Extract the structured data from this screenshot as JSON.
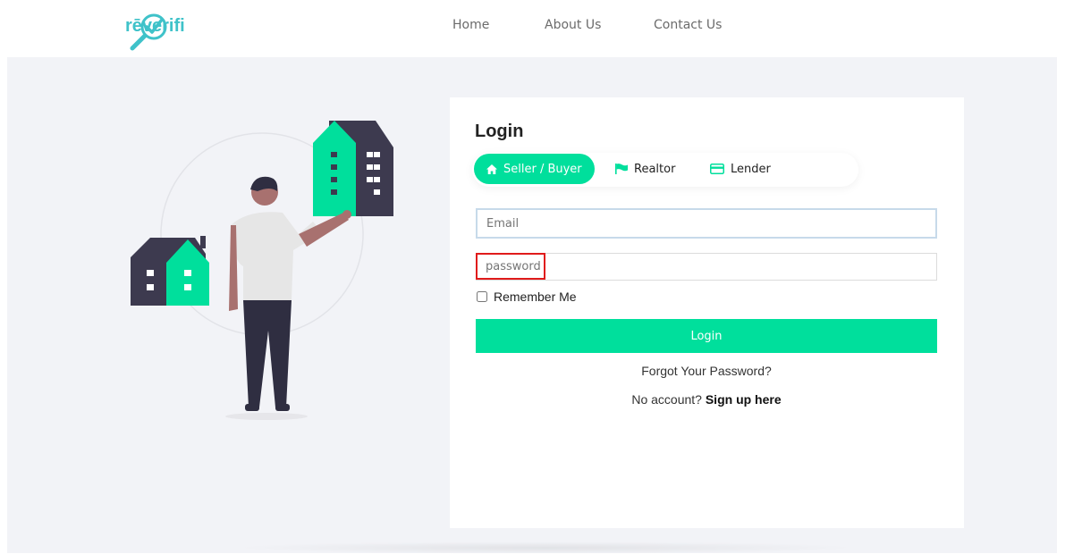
{
  "header": {
    "logo_text": "rēverifi",
    "nav": [
      {
        "label": "Home"
      },
      {
        "label": "About Us"
      },
      {
        "label": "Contact Us"
      }
    ]
  },
  "login": {
    "title": "Login",
    "tabs": [
      {
        "label": "Seller / Buyer",
        "icon": "home-icon",
        "active": true
      },
      {
        "label": "Realtor",
        "icon": "flag-icon",
        "active": false
      },
      {
        "label": "Lender",
        "icon": "credit-card-icon",
        "active": false
      }
    ],
    "email_placeholder": "Email",
    "password_placeholder": "password",
    "remember_label": "Remember Me",
    "submit_label": "Login",
    "forgot_label": "Forgot Your Password?",
    "no_account_label": "No account?",
    "signup_label": "Sign up here"
  },
  "colors": {
    "accent": "#00df9c",
    "logo": "#3fc2c9",
    "background": "#f2f3f7",
    "highlight": "#e01b1b"
  }
}
